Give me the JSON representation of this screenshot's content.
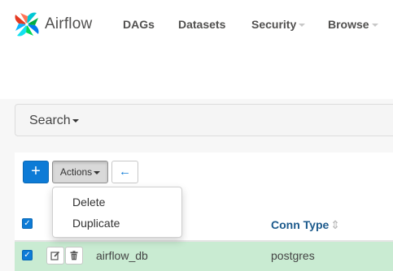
{
  "brand": {
    "name": "Airflow"
  },
  "nav": [
    {
      "label": "DAGs",
      "has_caret": false
    },
    {
      "label": "Datasets",
      "has_caret": false
    },
    {
      "label": "Security",
      "has_caret": true
    },
    {
      "label": "Browse",
      "has_caret": true
    }
  ],
  "search": {
    "label": "Search"
  },
  "toolbar": {
    "add_label": "+",
    "actions_label": "Actions",
    "back_icon": "arrow-left-icon"
  },
  "actions_menu": {
    "items": [
      "Delete",
      "Duplicate"
    ]
  },
  "table": {
    "columns": {
      "conn_type": "Conn Type"
    },
    "rows": [
      {
        "checked": true,
        "conn_id": "airflow_db",
        "conn_type": "postgres"
      }
    ]
  },
  "colors": {
    "primary": "#0d7bd6",
    "row_selected": "#c9ebd2",
    "header_link": "#1c5a8c"
  }
}
